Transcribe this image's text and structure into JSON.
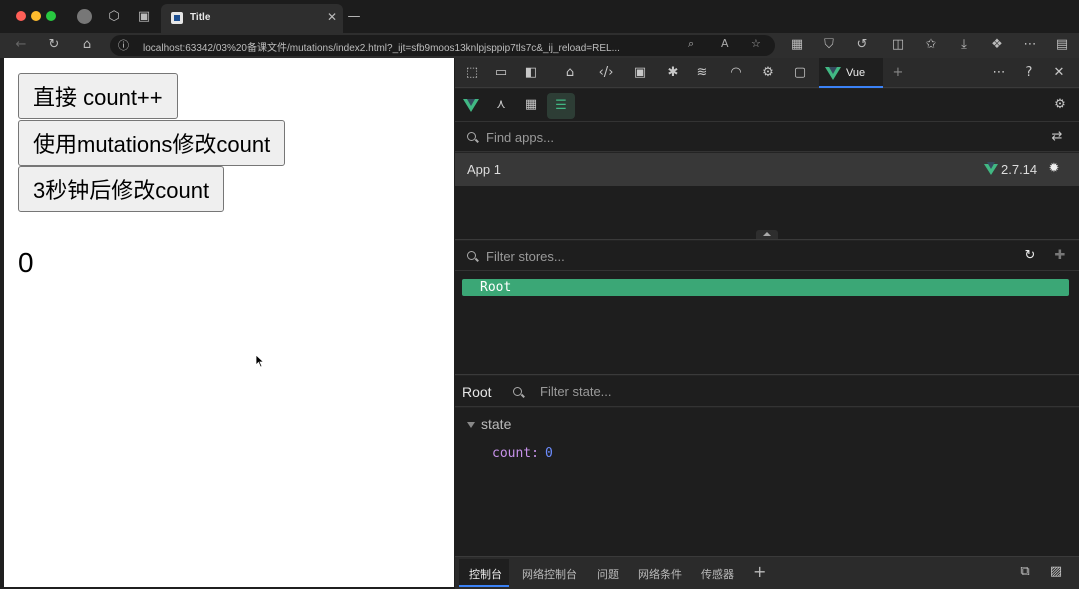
{
  "browser": {
    "tab_title": "Title",
    "tab_close": "✕",
    "new_tab": "—",
    "url": "localhost:63342/03%20备课文件/mutations/index2.html?_ijt=sfb9moos13knlpjsppip7tls7c&_ij_reload=REL..."
  },
  "page": {
    "buttons": [
      {
        "label": "直接 count++"
      },
      {
        "label": "使用mutations修改count"
      },
      {
        "label": "3秒钟后修改count"
      }
    ],
    "count": "0"
  },
  "devtools": {
    "vue_tab_label": "Vue",
    "find_apps_placeholder": "Find apps...",
    "app_name": "App 1",
    "vue_version": "2.7.14",
    "filter_stores_placeholder": "Filter stores...",
    "store_root": "Root",
    "state_header": "Root",
    "filter_state_placeholder": "Filter state...",
    "state_section": "state",
    "state_key": "count:",
    "state_value": "0",
    "drawer_tabs": [
      "控制台",
      "网络控制台",
      "问题",
      "网络条件",
      "传感器"
    ],
    "drawer_add": "+"
  },
  "colors": {
    "vue_green": "#41b883",
    "root_highlight": "#3ba776",
    "active_tab_accent": "#3b82f6"
  }
}
